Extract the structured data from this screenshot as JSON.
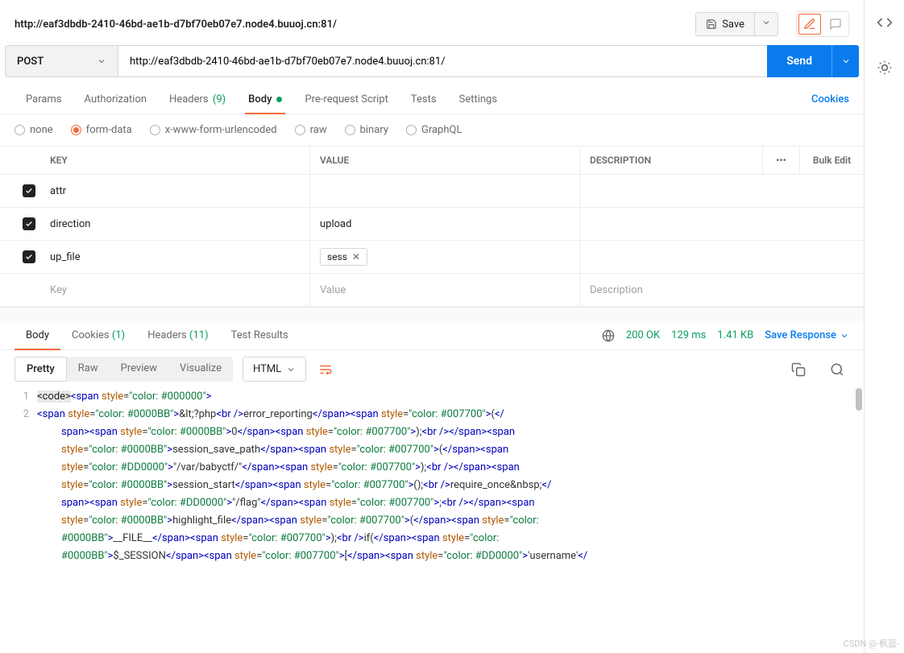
{
  "header": {
    "request_name": "http://eaf3dbdb-2410-46bd-ae1b-d7bf70eb07e7.node4.buuoj.cn:81/",
    "save_label": "Save"
  },
  "url_bar": {
    "method": "POST",
    "url": "http://eaf3dbdb-2410-46bd-ae1b-d7bf70eb07e7.node4.buuoj.cn:81/",
    "send_label": "Send"
  },
  "tabs": {
    "params": "Params",
    "authorization": "Authorization",
    "headers": "Headers",
    "headers_count": "(9)",
    "body": "Body",
    "prerequest": "Pre-request Script",
    "tests": "Tests",
    "settings": "Settings",
    "cookies": "Cookies"
  },
  "body_types": {
    "none": "none",
    "formdata": "form-data",
    "xwww": "x-www-form-urlencoded",
    "raw": "raw",
    "binary": "binary",
    "graphql": "GraphQL"
  },
  "kv": {
    "hdr_key": "KEY",
    "hdr_value": "VALUE",
    "hdr_desc": "DESCRIPTION",
    "bulk_edit": "Bulk Edit",
    "more": "•••",
    "rows": [
      {
        "key": "attr",
        "value": "",
        "desc": ""
      },
      {
        "key": "direction",
        "value": "upload",
        "desc": ""
      },
      {
        "key": "up_file",
        "value": "sess",
        "is_file": true,
        "desc": ""
      }
    ],
    "placeholder_key": "Key",
    "placeholder_value": "Value",
    "placeholder_desc": "Description"
  },
  "response": {
    "tabs": {
      "body": "Body",
      "cookies": "Cookies",
      "cookies_count": "(1)",
      "headers": "Headers",
      "headers_count": "(11)",
      "test_results": "Test Results"
    },
    "status": "200 OK",
    "time": "129 ms",
    "size": "1.41 KB",
    "save_response": "Save Response"
  },
  "view": {
    "pretty": "Pretty",
    "raw": "Raw",
    "preview": "Preview",
    "visualize": "Visualize",
    "lang": "HTML"
  },
  "code": {
    "gutter": [
      "1",
      "2"
    ],
    "line1_html": "<span class='hl-tag'>&lt;code&gt;</span><span class='c-tag'>&lt;span</span> <span class='c-attr'>style</span><span class='c-eq'>=</span><span class='c-val'>\"color: #000000\"</span><span class='c-tag'>&gt;</span>",
    "line2_html": "<span class='c-tag'>&lt;span</span> <span class='c-attr'>style</span><span class='c-eq'>=</span><span class='c-val'>\"color: #0000BB\"</span><span class='c-tag'>&gt;</span><span class='c-text'>&amp;lt;?php</span><span class='c-tag'>&lt;br /&gt;</span><span class='c-text'>error_reporting</span><span class='c-tag'>&lt;/span&gt;&lt;span</span> <span class='c-attr'>style</span><span class='c-eq'>=</span><span class='c-val'>\"color: #007700\"</span><span class='c-tag'>&gt;</span><span class='c-text'>(</span><span class='c-tag'>&lt;/</span><span class='pl'><span class='c-tag'>span&gt;&lt;span</span> <span class='c-attr'>style</span><span class='c-eq'>=</span><span class='c-val'>\"color: #0000BB\"</span><span class='c-tag'>&gt;</span><span class='c-text'>0</span><span class='c-tag'>&lt;/span&gt;&lt;span</span> <span class='c-attr'>style</span><span class='c-eq'>=</span><span class='c-val'>\"color: #007700\"</span><span class='c-tag'>&gt;</span><span class='c-text'>);</span><span class='c-tag'>&lt;br /&gt;&lt;/span&gt;&lt;span</span></span><span class='pl'><span class='c-attr'>style</span><span class='c-eq'>=</span><span class='c-val'>\"color: #0000BB\"</span><span class='c-tag'>&gt;</span><span class='c-text'>session_save_path</span><span class='c-tag'>&lt;/span&gt;&lt;span</span> <span class='c-attr'>style</span><span class='c-eq'>=</span><span class='c-val'>\"color: #007700\"</span><span class='c-tag'>&gt;</span><span class='c-text'>(</span><span class='c-tag'>&lt;/span&gt;&lt;span</span></span><span class='pl'><span class='c-attr'>style</span><span class='c-eq'>=</span><span class='c-val'>\"color: #DD0000\"</span><span class='c-tag'>&gt;</span><span class='c-text'>\"/var/babyctf/\"</span><span class='c-tag'>&lt;/span&gt;&lt;span</span> <span class='c-attr'>style</span><span class='c-eq'>=</span><span class='c-val'>\"color: #007700\"</span><span class='c-tag'>&gt;</span><span class='c-text'>);</span><span class='c-tag'>&lt;br /&gt;&lt;/span&gt;&lt;span</span></span><span class='pl'><span class='c-attr'>style</span><span class='c-eq'>=</span><span class='c-val'>\"color: #0000BB\"</span><span class='c-tag'>&gt;</span><span class='c-text'>session_start</span><span class='c-tag'>&lt;/span&gt;&lt;span</span> <span class='c-attr'>style</span><span class='c-eq'>=</span><span class='c-val'>\"color: #007700\"</span><span class='c-tag'>&gt;</span><span class='c-text'>();</span><span class='c-tag'>&lt;br /&gt;</span><span class='c-text'>require_once&amp;nbsp;</span><span class='c-tag'>&lt;/</span></span><span class='pl'><span class='c-tag'>span&gt;&lt;span</span> <span class='c-attr'>style</span><span class='c-eq'>=</span><span class='c-val'>\"color: #DD0000\"</span><span class='c-tag'>&gt;</span><span class='c-text'>\"/flag\"</span><span class='c-tag'>&lt;/span&gt;&lt;span</span> <span class='c-attr'>style</span><span class='c-eq'>=</span><span class='c-val'>\"color: #007700\"</span><span class='c-tag'>&gt;</span><span class='c-text'>;</span><span class='c-tag'>&lt;br /&gt;&lt;/span&gt;&lt;span</span></span><span class='pl'><span class='c-attr'>style</span><span class='c-eq'>=</span><span class='c-val'>\"color: #0000BB\"</span><span class='c-tag'>&gt;</span><span class='c-text'>highlight_file</span><span class='c-tag'>&lt;/span&gt;&lt;span</span> <span class='c-attr'>style</span><span class='c-eq'>=</span><span class='c-val'>\"color: #007700\"</span><span class='c-tag'>&gt;</span><span class='c-text'>(</span><span class='c-tag'>&lt;/span&gt;&lt;span</span> <span class='c-attr'>style</span><span class='c-eq'>=</span><span class='c-val'>\"color:</span></span><span class='pl'><span class='c-val'>#0000BB\"</span><span class='c-tag'>&gt;</span><span class='c-text'>__FILE__</span><span class='c-tag'>&lt;/span&gt;&lt;span</span> <span class='c-attr'>style</span><span class='c-eq'>=</span><span class='c-val'>\"color: #007700\"</span><span class='c-tag'>&gt;</span><span class='c-text'>);</span><span class='c-tag'>&lt;br /&gt;</span><span class='c-text'>if(</span><span class='c-tag'>&lt;/span&gt;&lt;span</span> <span class='c-attr'>style</span><span class='c-eq'>=</span><span class='c-val'>\"color:</span></span><span class='pl'><span class='c-val'>#0000BB\"</span><span class='c-tag'>&gt;</span><span class='c-text'>$_SESSION</span><span class='c-tag'>&lt;/span&gt;&lt;span</span> <span class='c-attr'>style</span><span class='c-eq'>=</span><span class='c-val'>\"color: #007700\"</span><span class='c-tag'>&gt;</span><span class='c-text'>[</span><span class='c-tag'>&lt;/span&gt;&lt;span</span> <span class='c-attr'>style</span><span class='c-eq'>=</span><span class='c-val'>\"color: #DD0000\"</span><span class='c-tag'>&gt;</span><span class='c-text'>'username'</span><span class='c-tag'>&lt;/</span></span>"
  },
  "watermark": "CSDN @-枫蓝-"
}
